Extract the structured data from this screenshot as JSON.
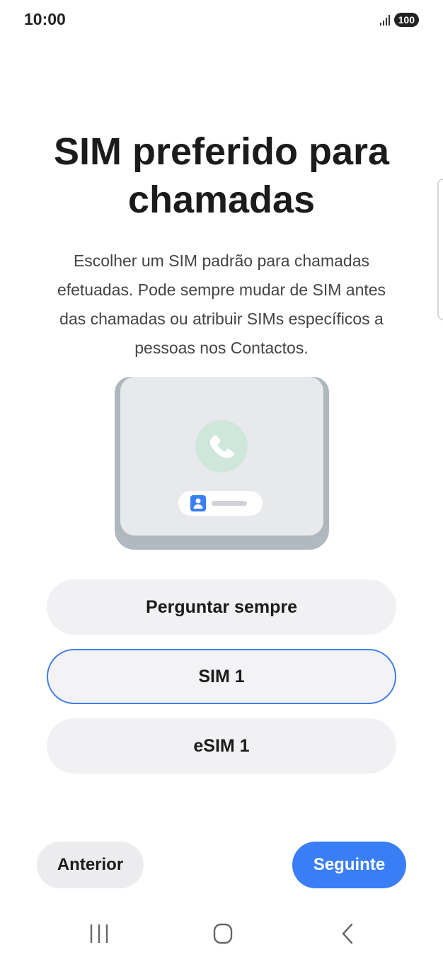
{
  "status_bar": {
    "time": "10:00",
    "battery": "100"
  },
  "screen": {
    "title": "SIM preferido para chamadas",
    "description": "Escolher um SIM padrão para chamadas efetuadas. Pode sempre mudar de SIM antes das chamadas ou atribuir SIMs específicos a pessoas nos Contactos."
  },
  "options": [
    {
      "label": "Perguntar sempre",
      "selected": false
    },
    {
      "label": "SIM 1",
      "selected": true
    },
    {
      "label": "eSIM 1",
      "selected": false
    }
  ],
  "footer": {
    "previous_label": "Anterior",
    "next_label": "Seguinte"
  },
  "icons": {
    "illustration_phone": "phone-icon",
    "illustration_contact": "contact-icon",
    "signal": "signal-icon",
    "nav_recent": "recent-apps-icon",
    "nav_home": "home-icon",
    "nav_back": "back-icon"
  },
  "colors": {
    "accent": "#3a7ef5",
    "selected_border": "#3f7ee8",
    "option_bg": "#f1f1f3",
    "phone_circle": "#cfe7da"
  }
}
